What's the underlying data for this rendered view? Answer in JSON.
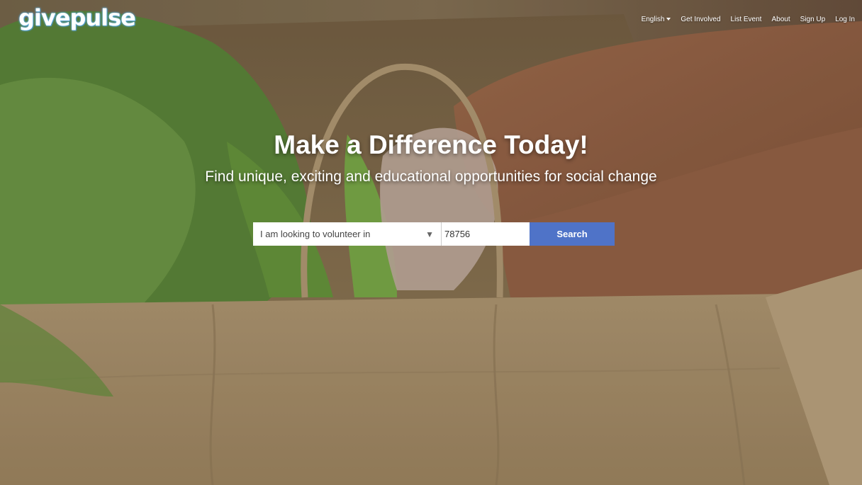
{
  "brand": {
    "logo_text": "givepulse",
    "logo_color": "#5aa9d6"
  },
  "nav": {
    "language": "English",
    "items": [
      "Get Involved",
      "List Event",
      "About",
      "Sign Up",
      "Log In"
    ]
  },
  "hero": {
    "headline": "Make a Difference Today!",
    "subheadline": "Find unique, exciting and educational opportunities for social change"
  },
  "search": {
    "category_value": "I am looking to volunteer in",
    "zip_value": "78756",
    "button_label": "Search",
    "button_color": "#4f73c8"
  }
}
